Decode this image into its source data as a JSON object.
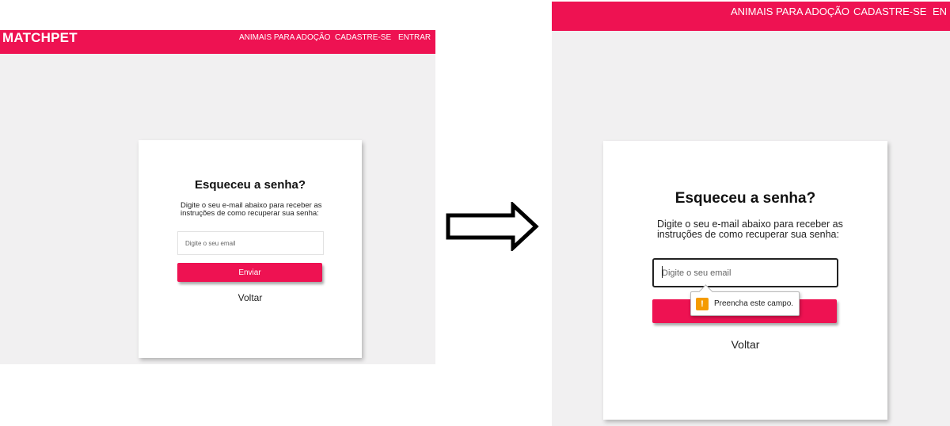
{
  "brand": "MATCHPET",
  "nav": {
    "adopt": "ANIMAIS PARA ADOÇÃO",
    "register": "CADASTRE-SE",
    "login": "ENTRAR",
    "login_cut": "EN"
  },
  "form": {
    "title": "Esqueceu a senha?",
    "description": "Digite o seu e-mail abaixo para receber as instruções de como recuperar sua senha:",
    "email_placeholder": "Digite o seu email",
    "submit_label": "Enviar",
    "back_label": "Voltar"
  },
  "validation": {
    "icon": "warning-icon",
    "glyph": "!",
    "message": "Preencha este campo."
  },
  "arrow_icon": "right-arrow-icon",
  "colors": {
    "brand_pink": "#ee1252",
    "page_bg": "#f1f0f1",
    "card_bg": "#ffffff",
    "warning": "#f59b00"
  }
}
